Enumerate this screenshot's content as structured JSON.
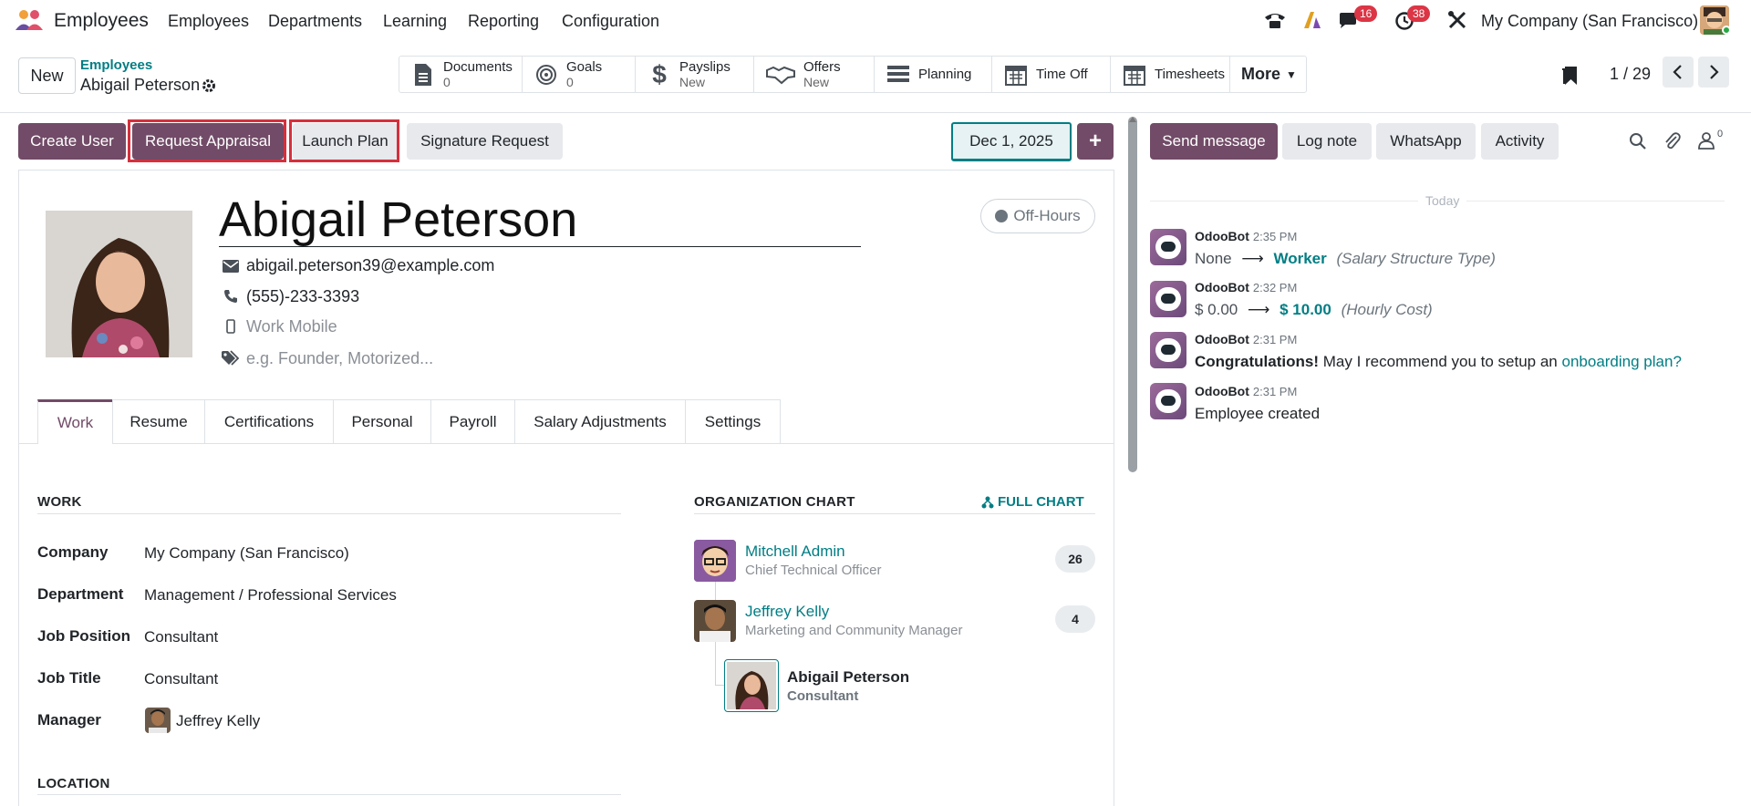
{
  "navbar": {
    "app_name": "Employees",
    "menus": [
      "Employees",
      "Departments",
      "Learning",
      "Reporting",
      "Configuration"
    ],
    "messages_badge": "16",
    "activities_badge": "38",
    "company": "My Company (San Francisco)"
  },
  "control": {
    "new_label": "New",
    "breadcrumb_parent": "Employees",
    "record_name": "Abigail Peterson",
    "pager": "1 / 29",
    "smart_buttons": [
      {
        "label": "Documents",
        "value": "0",
        "icon": "file-icon"
      },
      {
        "label": "Goals",
        "value": "0",
        "icon": "target-icon"
      },
      {
        "label": "Payslips",
        "value": "New",
        "icon": "dollar-icon"
      },
      {
        "label": "Offers",
        "value": "New",
        "icon": "handshake-icon"
      },
      {
        "label": "Planning",
        "value": "",
        "icon": "planning-icon"
      },
      {
        "label": "Time Off",
        "value": "",
        "icon": "calendar-icon"
      },
      {
        "label": "Timesheets",
        "value": "",
        "icon": "calendar-icon"
      },
      {
        "label": "More",
        "value": "",
        "icon": "caret-down-icon"
      }
    ]
  },
  "statusbar": {
    "create_user": "Create User",
    "request_appraisal": "Request Appraisal",
    "launch_plan": "Launch Plan",
    "signature_request": "Signature Request",
    "date": "Dec 1, 2025",
    "plus": "+"
  },
  "employee": {
    "name": "Abigail Peterson",
    "status": "Off-Hours",
    "email": "abigail.peterson39@example.com",
    "phone": "(555)-233-3393",
    "mobile_placeholder": "Work Mobile",
    "tags_placeholder": "e.g. Founder, Motorized..."
  },
  "tabs": [
    "Work",
    "Resume",
    "Certifications",
    "Personal",
    "Payroll",
    "Salary Adjustments",
    "Settings"
  ],
  "work": {
    "section_title": "WORK",
    "fields": [
      {
        "label": "Company",
        "value": "My Company (San Francisco)"
      },
      {
        "label": "Department",
        "value": "Management / Professional Services"
      },
      {
        "label": "Job Position",
        "value": "Consultant"
      },
      {
        "label": "Job Title",
        "value": "Consultant"
      },
      {
        "label": "Manager",
        "value": "Jeffrey Kelly"
      }
    ],
    "location_title": "LOCATION"
  },
  "org_chart": {
    "title": "ORGANIZATION CHART",
    "full_chart": "FULL CHART",
    "people": [
      {
        "name": "Mitchell Admin",
        "role": "Chief Technical Officer",
        "count": "26"
      },
      {
        "name": "Jeffrey Kelly",
        "role": "Marketing and Community Manager",
        "count": "4"
      },
      {
        "name": "Abigail Peterson",
        "role": "Consultant",
        "count": ""
      }
    ]
  },
  "chatter": {
    "send_message": "Send message",
    "log_note": "Log note",
    "whatsapp": "WhatsApp",
    "activity": "Activity",
    "followers": "0",
    "today": "Today",
    "messages": [
      {
        "author": "OdooBot",
        "time": "2:35 PM",
        "old": "None",
        "new": "Worker",
        "field": "(Salary Structure Type)"
      },
      {
        "author": "OdooBot",
        "time": "2:32 PM",
        "old": "$ 0.00",
        "new": "$ 10.00",
        "field": "(Hourly Cost)"
      },
      {
        "author": "OdooBot",
        "time": "2:31 PM",
        "bold": "Congratulations!",
        "text": "May I recommend you to setup an",
        "link": "onboarding plan?"
      },
      {
        "author": "OdooBot",
        "time": "2:31 PM",
        "text": "Employee created"
      }
    ]
  },
  "colors": {
    "primary": "#714b67",
    "link": "#017e84",
    "highlight": "#d62f3c"
  }
}
